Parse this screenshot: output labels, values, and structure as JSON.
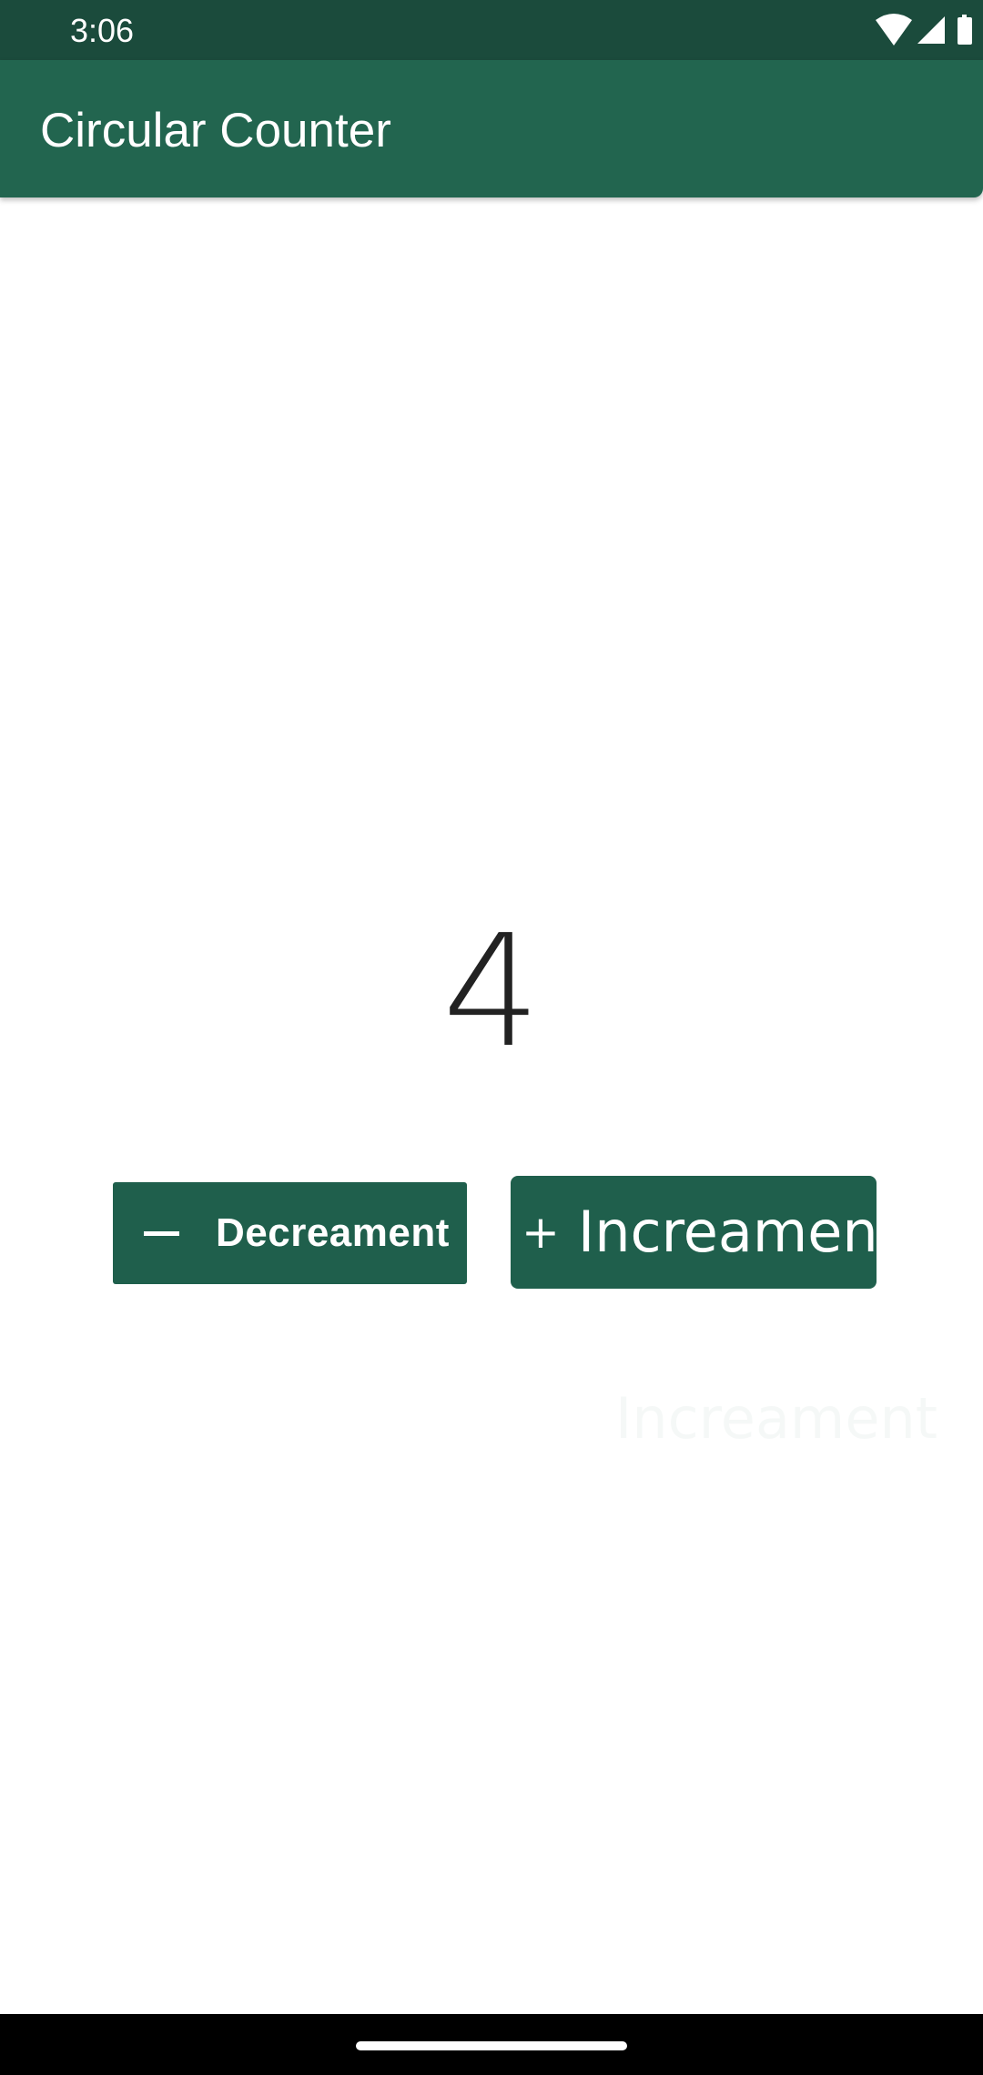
{
  "status_bar": {
    "time": "3:06",
    "icons": [
      "wifi-icon",
      "cellular-signal-icon",
      "battery-icon"
    ]
  },
  "app_bar": {
    "title": "Circular Counter",
    "color": "#22654f"
  },
  "counter": {
    "value": "4"
  },
  "buttons": {
    "decrement": {
      "icon": "minus-icon",
      "label": "Decreament"
    },
    "increment": {
      "icon": "plus-icon",
      "icon_glyph": "+",
      "label": "Increament"
    }
  },
  "ghost": {
    "text": "Increament"
  },
  "colors": {
    "status_bar": "#1b4b3c",
    "primary": "#22654f",
    "button": "#1f5f4c",
    "background": "#ffffff"
  }
}
